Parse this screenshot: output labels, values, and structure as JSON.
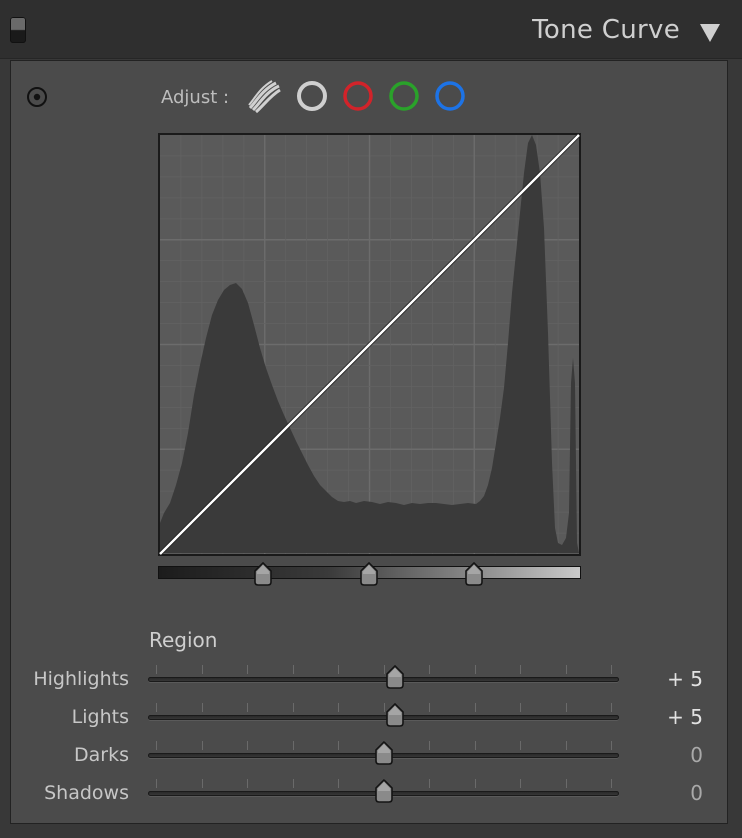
{
  "header": {
    "title": "Tone Curve"
  },
  "adjust": {
    "label": "Adjust :",
    "channels": [
      {
        "name": "parametric",
        "icon": "parametric-curve-icon",
        "color": "#cfcfcf"
      },
      {
        "name": "point",
        "icon": "point-curve-icon",
        "color": "#cfcfcf"
      },
      {
        "name": "red",
        "icon": "red-channel-icon",
        "color": "#d2232a"
      },
      {
        "name": "green",
        "icon": "green-channel-icon",
        "color": "#2aa22a"
      },
      {
        "name": "blue",
        "icon": "blue-channel-icon",
        "color": "#1d73e6"
      }
    ]
  },
  "split_points": [
    0.25,
    0.5,
    0.75
  ],
  "region": {
    "heading": "Region",
    "sliders": [
      {
        "key": "highlights",
        "label": "Highlights",
        "value": 5,
        "display": "+ 5"
      },
      {
        "key": "lights",
        "label": "Lights",
        "value": 5,
        "display": "+ 5"
      },
      {
        "key": "darks",
        "label": "Darks",
        "value": 0,
        "display": "0"
      },
      {
        "key": "shadows",
        "label": "Shadows",
        "value": 0,
        "display": "0"
      }
    ],
    "range": [
      -100,
      100
    ]
  },
  "colors": {
    "background": "#383838",
    "panel": "#4b4b4b",
    "curve_bg": "#595959",
    "histogram": "#3a3a3a",
    "curve_line": "#ffffff"
  }
}
